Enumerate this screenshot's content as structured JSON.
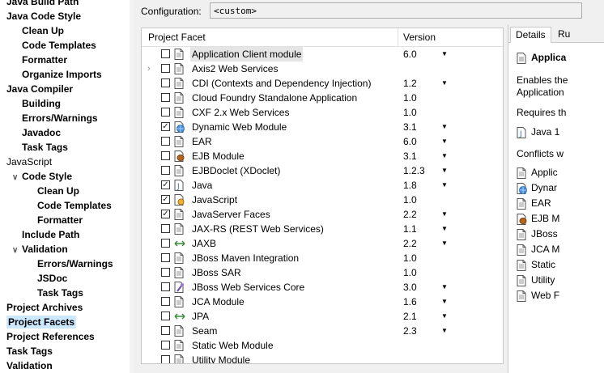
{
  "nav": {
    "items": [
      {
        "label": "Java Build Path",
        "indent": 0,
        "bold": true
      },
      {
        "label": "Java Code Style",
        "indent": 0,
        "bold": true
      },
      {
        "label": "Clean Up",
        "indent": 1,
        "bold": true
      },
      {
        "label": "Code Templates",
        "indent": 1,
        "bold": true
      },
      {
        "label": "Formatter",
        "indent": 1,
        "bold": true
      },
      {
        "label": "Organize Imports",
        "indent": 1,
        "bold": true
      },
      {
        "label": "Java Compiler",
        "indent": 0,
        "bold": true
      },
      {
        "label": "Building",
        "indent": 1,
        "bold": true
      },
      {
        "label": "Errors/Warnings",
        "indent": 1,
        "bold": true
      },
      {
        "label": "Javadoc",
        "indent": 1,
        "bold": true
      },
      {
        "label": "Task Tags",
        "indent": 1,
        "bold": true
      },
      {
        "label": "JavaScript",
        "indent": 0,
        "bold": false
      },
      {
        "label": "Code Style",
        "indent": 1,
        "bold": true,
        "expanded": true
      },
      {
        "label": "Clean Up",
        "indent": 2,
        "bold": true
      },
      {
        "label": "Code Templates",
        "indent": 2,
        "bold": true
      },
      {
        "label": "Formatter",
        "indent": 2,
        "bold": true
      },
      {
        "label": "Include Path",
        "indent": 1,
        "bold": true
      },
      {
        "label": "Validation",
        "indent": 1,
        "bold": true,
        "expanded": true
      },
      {
        "label": "Errors/Warnings",
        "indent": 2,
        "bold": true
      },
      {
        "label": "JSDoc",
        "indent": 2,
        "bold": true
      },
      {
        "label": "Task Tags",
        "indent": 2,
        "bold": true
      },
      {
        "label": "Project Archives",
        "indent": 0,
        "bold": true
      },
      {
        "label": "Project Facets",
        "indent": 0,
        "bold": true,
        "selected": true
      },
      {
        "label": "Project References",
        "indent": 0,
        "bold": true
      },
      {
        "label": "Task Tags",
        "indent": 0,
        "bold": true
      },
      {
        "label": "Validation",
        "indent": 0,
        "bold": true
      }
    ]
  },
  "config": {
    "label": "Configuration:",
    "value": "<custom>"
  },
  "table": {
    "col_facet": "Project Facet",
    "col_version": "Version",
    "rows": [
      {
        "name": "Application Client module",
        "version": "6.0",
        "checked": false,
        "icon": "page",
        "dropdown": true,
        "highlight": true
      },
      {
        "name": "Axis2 Web Services",
        "version": "",
        "checked": false,
        "icon": "page",
        "dropdown": false,
        "expandable": true
      },
      {
        "name": "CDI (Contexts and Dependency Injection)",
        "version": "1.2",
        "checked": false,
        "icon": "page",
        "dropdown": true
      },
      {
        "name": "Cloud Foundry Standalone Application",
        "version": "1.0",
        "checked": false,
        "icon": "page",
        "dropdown": false
      },
      {
        "name": "CXF 2.x Web Services",
        "version": "1.0",
        "checked": false,
        "icon": "page",
        "dropdown": false
      },
      {
        "name": "Dynamic Web Module",
        "version": "3.1",
        "checked": true,
        "icon": "globe",
        "dropdown": true
      },
      {
        "name": "EAR",
        "version": "6.0",
        "checked": false,
        "icon": "page",
        "dropdown": true
      },
      {
        "name": "EJB Module",
        "version": "3.1",
        "checked": false,
        "icon": "bean",
        "dropdown": true
      },
      {
        "name": "EJBDoclet (XDoclet)",
        "version": "1.2.3",
        "checked": false,
        "icon": "page",
        "dropdown": true
      },
      {
        "name": "Java",
        "version": "1.8",
        "checked": true,
        "icon": "java",
        "dropdown": true
      },
      {
        "name": "JavaScript",
        "version": "1.0",
        "checked": true,
        "icon": "js",
        "dropdown": false
      },
      {
        "name": "JavaServer Faces",
        "version": "2.2",
        "checked": true,
        "icon": "page",
        "dropdown": true
      },
      {
        "name": "JAX-RS (REST Web Services)",
        "version": "1.1",
        "checked": false,
        "icon": "page",
        "dropdown": true
      },
      {
        "name": "JAXB",
        "version": "2.2",
        "checked": false,
        "icon": "arrows",
        "dropdown": true
      },
      {
        "name": "JBoss Maven Integration",
        "version": "1.0",
        "checked": false,
        "icon": "page",
        "dropdown": false
      },
      {
        "name": "JBoss SAR",
        "version": "1.0",
        "checked": false,
        "icon": "page",
        "dropdown": false
      },
      {
        "name": "JBoss Web Services Core",
        "version": "3.0",
        "checked": false,
        "icon": "ws",
        "dropdown": true
      },
      {
        "name": "JCA Module",
        "version": "1.6",
        "checked": false,
        "icon": "page",
        "dropdown": true
      },
      {
        "name": "JPA",
        "version": "2.1",
        "checked": false,
        "icon": "arrows",
        "dropdown": true
      },
      {
        "name": "Seam",
        "version": "2.3",
        "checked": false,
        "icon": "page",
        "dropdown": true
      },
      {
        "name": "Static Web Module",
        "version": "",
        "checked": false,
        "icon": "page",
        "dropdown": false
      },
      {
        "name": "Utility Module",
        "version": "",
        "checked": false,
        "icon": "page",
        "dropdown": false
      }
    ]
  },
  "details": {
    "tab_details": "Details",
    "tab_other": "Ru",
    "facet_title": "Applica",
    "desc_line1": "Enables the",
    "desc_line2": "Application",
    "requires_label": "Requires th",
    "requires_item": "Java 1",
    "conflicts_label": "Conflicts w",
    "conflicts": [
      {
        "text": "Applic",
        "icon": "page"
      },
      {
        "text": "Dynar",
        "icon": "globe"
      },
      {
        "text": "EAR",
        "icon": "page"
      },
      {
        "text": "EJB M",
        "icon": "bean"
      },
      {
        "text": "JBoss",
        "icon": "page"
      },
      {
        "text": "JCA M",
        "icon": "page"
      },
      {
        "text": "Static",
        "icon": "page"
      },
      {
        "text": "Utility",
        "icon": "page"
      },
      {
        "text": "Web F",
        "icon": "page"
      }
    ]
  },
  "colors": {
    "selection": "#cce8ff",
    "accent": "#2b6cb0",
    "check": "#222222"
  }
}
